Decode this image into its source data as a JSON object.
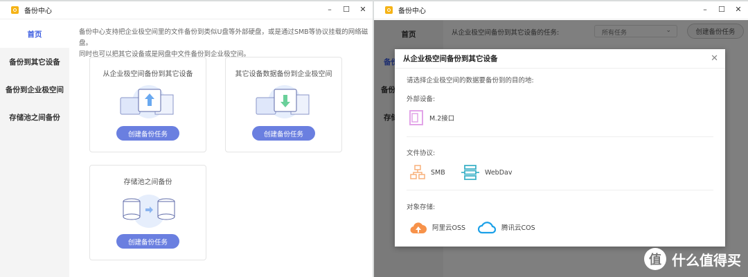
{
  "left_window": {
    "title": "备份中心",
    "sidebar": [
      {
        "label": "首页",
        "active": true
      },
      {
        "label": "备份到其它设备"
      },
      {
        "label": "备份到企业极空间"
      },
      {
        "label": "存储池之间备份"
      }
    ],
    "intro": [
      "备份中心支持把企业极空间里的文件备份到类似U盘等外部硬盘，或是通过SMB等协议挂载的网络磁盘。",
      "同时也可以把其它设备或是网盘中文件备份到企业极空间。"
    ],
    "cards": [
      {
        "title": "从企业极空间备份到其它设备",
        "button": "创建备份任务"
      },
      {
        "title": "其它设备数据备份到企业极空间",
        "button": "创建备份任务"
      },
      {
        "title": "存储池之间备份",
        "button": "创建备份任务"
      }
    ]
  },
  "right_window": {
    "title": "备份中心",
    "sidebar": [
      "首页",
      "备份",
      "备份",
      "存储"
    ],
    "header_label": "从企业极空间备份到其它设备的任务:",
    "filter_value": "所有任务",
    "create_button": "创建备份任务",
    "modal": {
      "title": "从企业极空间备份到其它设备",
      "prompt": "请选择企业极空间的数据要备份到的目的地:",
      "sections": [
        {
          "label": "外部设备:",
          "options": [
            "M.2接口"
          ]
        },
        {
          "label": "文件协议:",
          "options": [
            "SMB",
            "WebDav"
          ]
        },
        {
          "label": "对象存储:",
          "options": [
            "阿里云OSS",
            "腾讯云COS"
          ]
        }
      ]
    }
  },
  "watermark": {
    "glyph": "值",
    "text": "什么值得买"
  },
  "colors": {
    "accent": "#6a7fe0",
    "active_nav": "#3b5ce0",
    "logo": "#f5b316"
  }
}
